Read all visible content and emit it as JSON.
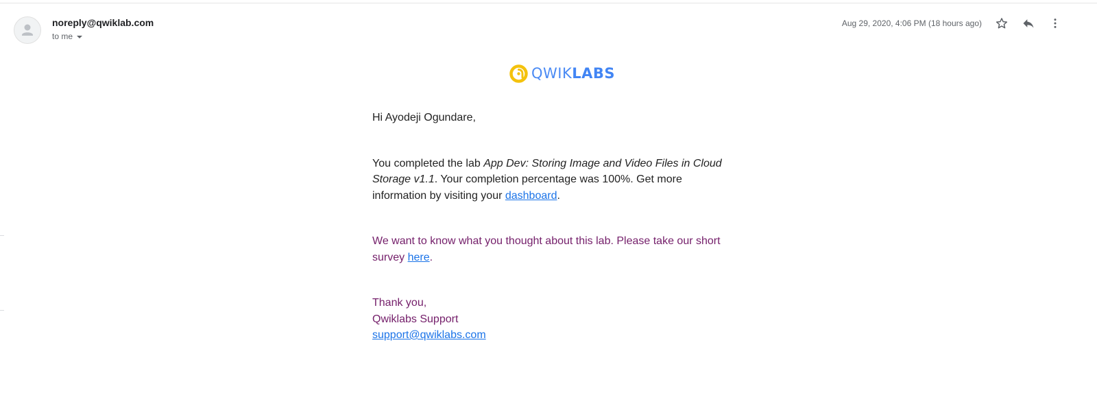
{
  "header": {
    "sender": "noreply@qwiklab.com",
    "recipient": "to me",
    "timestamp": "Aug 29, 2020, 4:06 PM (18 hours ago)",
    "icons": {
      "avatar": "person-avatar-icon",
      "star": "star-outline-icon",
      "reply": "reply-icon",
      "more": "more-vert-icon"
    }
  },
  "logo": {
    "text_light": "QWIK",
    "text_bold": "LABS",
    "colors": {
      "ring": "#f4c20d",
      "text": "#4285f4"
    }
  },
  "body": {
    "greeting": "Hi Ayodeji Ogundare,",
    "p1_a": "You completed the lab ",
    "p1_lab_name": "App Dev: Storing Image and Video Files in Cloud Storage v1.1",
    "p1_b": ". Your completion percentage was 100%. Get more information by visiting your ",
    "p1_link": "dashboard",
    "p1_end": ".",
    "p2_a": "We want to know what you thought about this lab. Please take our short survey ",
    "p2_link": "here",
    "p2_end": ".",
    "thanks": "Thank you,",
    "team": "Qwiklabs Support",
    "support_email": "support@qwiklabs.com"
  },
  "colors": {
    "link": "#1a73e8",
    "purple_text": "#75206b",
    "body_text": "#222222",
    "meta_text": "#5f6368"
  }
}
